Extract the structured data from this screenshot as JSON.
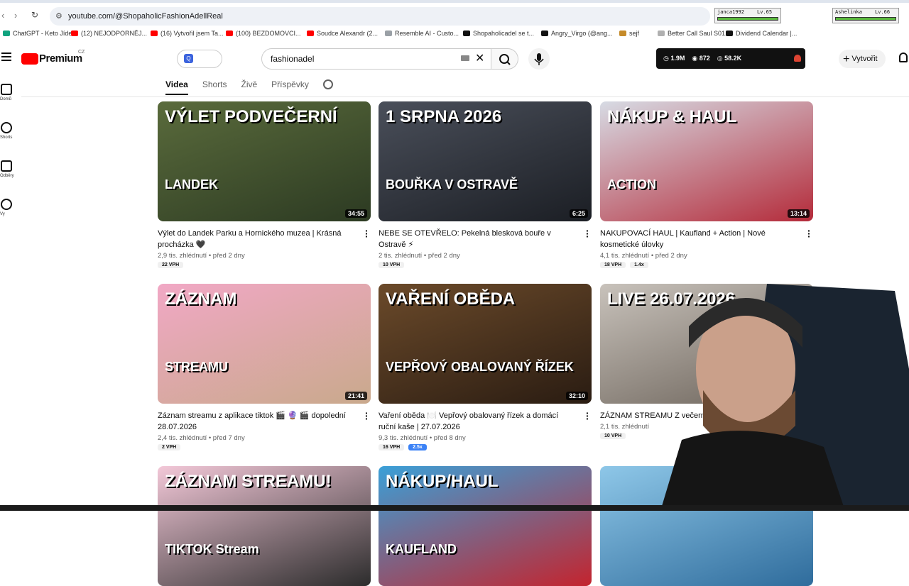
{
  "browser": {
    "url": "youtube.com/@ShopaholicFashionAdellReal",
    "game_players": [
      {
        "name": "janca1992",
        "level": "Lv.65"
      },
      {
        "name": "Ashelinka",
        "level": "Lv.66"
      }
    ],
    "bookmarks": [
      {
        "label": "ChatGPT - Keto Jíde...",
        "color": "#10a37f"
      },
      {
        "label": "(12) NEJODPORNĚJ...",
        "color": "#ff0000"
      },
      {
        "label": "(16) Vytvořil jsem Ta...",
        "color": "#ff0000"
      },
      {
        "label": "(100) BEZDOMOVCI...",
        "color": "#ff0000"
      },
      {
        "label": "Soudce Alexandr (2...",
        "color": "#ff0000"
      },
      {
        "label": "Resemble AI - Custo...",
        "color": "#9aa0a6"
      },
      {
        "label": "Shopaholicadel se t...",
        "color": "#111111"
      },
      {
        "label": "Angry_Virgo (@ang...",
        "color": "#111111"
      },
      {
        "label": "sejf",
        "color": "#c58b2a"
      },
      {
        "label": "Better Call Saul S01...",
        "color": "#b0b0b0"
      },
      {
        "label": "Dividend Calendar |...",
        "color": "#111111"
      }
    ]
  },
  "masthead": {
    "logo_text": "Premium",
    "region": "CZ",
    "search_value": "fashionadel",
    "stats": [
      "1.9M",
      "872",
      "58.2K"
    ],
    "create_label": "Vytvořit"
  },
  "guide": [
    {
      "label": "Domů",
      "icon": "home-icon"
    },
    {
      "label": "Shorts",
      "icon": "shorts-icon"
    },
    {
      "label": "Odběry",
      "icon": "subscriptions-icon"
    },
    {
      "label": "Vy",
      "icon": "account-icon"
    }
  ],
  "tabs": [
    "Videa",
    "Shorts",
    "Živě",
    "Příspěvky"
  ],
  "videos": [
    {
      "title": "Výlet do Landek Parku a Hornického muzea | Krásná procházka 🖤",
      "views": "2,9 tis. zhlédnutí",
      "age": "před 2 dny",
      "duration": "34:55",
      "tags": [
        "22 VPH"
      ],
      "thumb_text": "VÝLET PODVEČERNÍ",
      "thumb_sub": "LANDEK",
      "colors": [
        "#5a6b3c",
        "#2c3a22"
      ]
    },
    {
      "title": "NEBE SE OTEVŘELO: Pekelná blesková bouře v Ostravě ⚡",
      "views": "2 tis. zhlédnutí",
      "age": "před 2 dny",
      "duration": "6:25",
      "tags": [
        "10 VPH"
      ],
      "thumb_text": "1 SRPNA 2026",
      "thumb_sub": "BOUŘKA V OSTRAVĚ",
      "colors": [
        "#4a4f5a",
        "#1b1e24"
      ]
    },
    {
      "title": "NAKUPOVACÍ HAUL | Kaufland + Action | Nové kosmetické úlovky",
      "views": "4,1 tis. zhlédnutí",
      "age": "před 2 dny",
      "duration": "13:14",
      "tags": [
        "18 VPH",
        "1.4x"
      ],
      "thumb_text": "NÁKUP & HAUL",
      "thumb_sub": "ACTION",
      "colors": [
        "#d7dbe4",
        "#b42b3a"
      ]
    },
    {
      "title": "Záznam streamu z aplikace tiktok 🎬 🔮 🎬 dopolední 28.07.2026",
      "views": "2,4 tis. zhlédnutí",
      "age": "před 7 dny",
      "duration": "21:41",
      "tags": [
        "2 VPH"
      ],
      "thumb_text": "ZÁZNAM",
      "thumb_sub": "STREAMU",
      "colors": [
        "#f1a8c5",
        "#c9a98c"
      ]
    },
    {
      "title": "Vaření oběda 🍽️ Vepřový obalovaný řízek a domácí ruční kaše | 27.07.2026",
      "views": "9,3 tis. zhlédnutí",
      "age": "před 8 dny",
      "duration": "32:10",
      "tags": [
        "16 VPH",
        "2.5x"
      ],
      "thumb_text": "VAŘENÍ OBĚDA",
      "thumb_sub": "VEPŘOVÝ OBALOVANÝ ŘÍZEK",
      "colors": [
        "#6b4a2a",
        "#2a1c12"
      ]
    },
    {
      "title": "ZÁZNAM STREAMU Z večerní 26.07.2026",
      "views": "2,1 tis. zhlédnutí",
      "age": "",
      "duration": "",
      "tags": [
        "10 VPH"
      ],
      "thumb_text": "LIVE 26.07.2026",
      "thumb_sub": "",
      "colors": [
        "#c8c2bb",
        "#6b6259"
      ]
    },
    {
      "title": "",
      "views": "",
      "age": "",
      "duration": "",
      "tags": [],
      "thumb_text": "ZÁZNAM STREAMU!",
      "thumb_sub": "TIKTOK Stream",
      "colors": [
        "#f3c8d8",
        "#2c2c2c"
      ]
    },
    {
      "title": "",
      "views": "",
      "age": "",
      "duration": "",
      "tags": [],
      "thumb_text": "NÁKUP/HAUL",
      "thumb_sub": "KAUFLAND",
      "colors": [
        "#3aa0d8",
        "#c4242e"
      ]
    },
    {
      "title": "",
      "views": "",
      "age": "",
      "duration": "",
      "tags": [],
      "thumb_text": "",
      "thumb_sub": "",
      "colors": [
        "#8ec7e8",
        "#2f6c9c"
      ]
    }
  ]
}
